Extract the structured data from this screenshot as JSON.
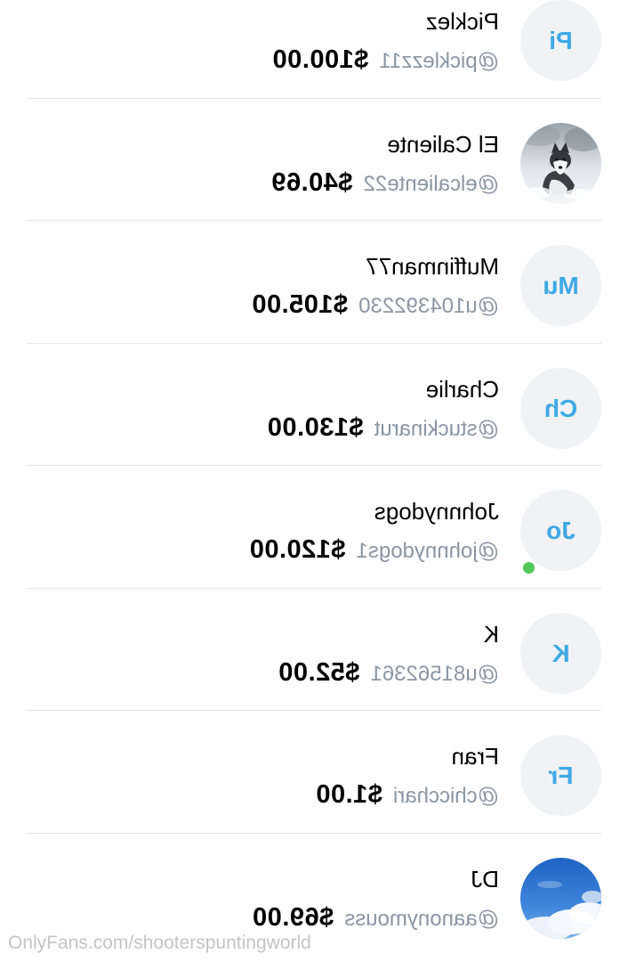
{
  "subscribers": [
    {
      "initials": "Pi",
      "name": "Picklez",
      "handle": "@picklezz11",
      "amount": "$100.00",
      "avatar_type": "initials",
      "online": false
    },
    {
      "initials": "",
      "name": "El Caliente",
      "handle": "@elcaliente22",
      "amount": "$40.69",
      "avatar_type": "photo-husky",
      "online": false
    },
    {
      "initials": "Mu",
      "name": "Muffinman77",
      "handle": "@u104392230",
      "amount": "$105.00",
      "avatar_type": "initials",
      "online": false
    },
    {
      "initials": "Ch",
      "name": "Charlie",
      "handle": "@stuckinarut",
      "amount": "$130.00",
      "avatar_type": "initials",
      "online": false
    },
    {
      "initials": "Jo",
      "name": "Johnnydogs",
      "handle": "@johnnydogs1",
      "amount": "$120.00",
      "avatar_type": "initials",
      "online": true
    },
    {
      "initials": "K",
      "name": "K",
      "handle": "@u81562361",
      "amount": "$52.00",
      "avatar_type": "initials",
      "online": false
    },
    {
      "initials": "Fr",
      "name": "Fran",
      "handle": "@chicchari",
      "amount": "$1.00",
      "avatar_type": "initials",
      "online": false
    },
    {
      "initials": "",
      "name": "DJ",
      "handle": "@aanonymouss",
      "amount": "$69.00",
      "avatar_type": "photo-sky",
      "online": false
    }
  ],
  "watermark": "OnlyFans.com/shooterspuntingworld",
  "colors": {
    "accent": "#3fa9e5",
    "avatar_bg": "#f0f2f5",
    "handle": "#8a96a3",
    "online": "#54c85a",
    "divider": "#e4e6e8"
  }
}
